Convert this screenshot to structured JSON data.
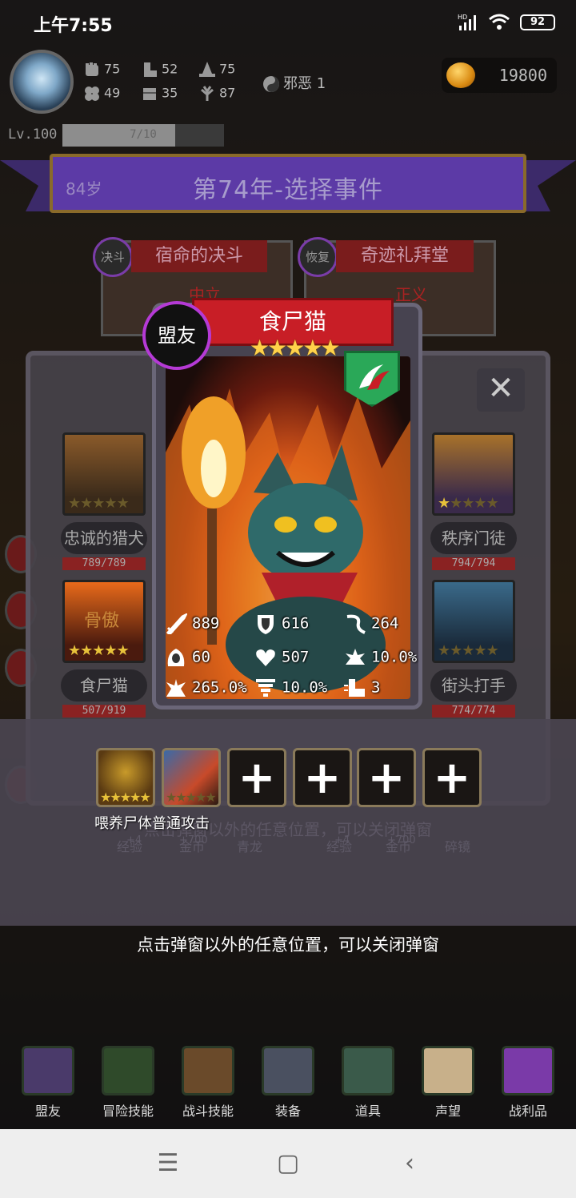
{
  "status_bar": {
    "time": "上午7:55",
    "battery": "92",
    "signal_label": "HD"
  },
  "player": {
    "stats": [
      {
        "icon": "fist-icon",
        "value": "75"
      },
      {
        "icon": "boot-icon",
        "value": "52"
      },
      {
        "icon": "wizard-hat-icon",
        "value": "75"
      },
      {
        "icon": "clover-icon",
        "value": "49"
      },
      {
        "icon": "chest-icon",
        "value": "35"
      },
      {
        "icon": "leaf-icon",
        "value": "87"
      }
    ],
    "alignment": "邪恶 1",
    "coins": "19800",
    "level": "Lv.100",
    "exp": "7/10",
    "exp_fraction": 0.7
  },
  "banner": {
    "age": "84岁",
    "title": "第74年-选择事件"
  },
  "events": [
    {
      "tag": "决斗",
      "name": "宿命的决斗",
      "alignment": "中立"
    },
    {
      "tag": "恢复",
      "name": "奇迹礼拜堂",
      "alignment": "正义"
    }
  ],
  "ghost_rewards": {
    "left": [
      {
        "top": "+4",
        "label": "经验"
      },
      {
        "top": "+700",
        "label": "金币"
      },
      {
        "top": "",
        "label": "青龙"
      }
    ],
    "right": [
      {
        "top": "+4",
        "label": "经验"
      },
      {
        "top": "+700",
        "label": "金币"
      },
      {
        "top": "",
        "label": "碎镜"
      }
    ],
    "hint": "点击弹窗以外的任意位置，可以关闭弹窗"
  },
  "allies": [
    {
      "name": "忠诚的猎犬",
      "hp": "789/789",
      "stars": 0,
      "colors": [
        "#3a2a1a",
        "#8a5a2a"
      ]
    },
    {
      "name": "秩序门徒",
      "hp": "794/794",
      "stars": 1,
      "colors": [
        "#3a2a4a",
        "#a8722a"
      ]
    },
    {
      "name": "食尸猫",
      "hp": "507/919",
      "stars": 5,
      "colors": [
        "#4a1a0e",
        "#e86a1a"
      ],
      "overlay": "骨傲"
    },
    {
      "name": "街头打手",
      "hp": "774/774",
      "stars": 0,
      "colors": [
        "#1a2a3a",
        "#3a6a8a"
      ]
    }
  ],
  "card": {
    "tag": "盟友",
    "name": "食尸猫",
    "stars": "★★★★★",
    "stats": [
      {
        "icon": "sword-icon",
        "value": "889"
      },
      {
        "icon": "shield-icon",
        "value": "616"
      },
      {
        "icon": "whip-icon",
        "value": "264"
      },
      {
        "icon": "hood-icon",
        "value": "60"
      },
      {
        "icon": "heart-icon",
        "value": "507"
      },
      {
        "icon": "burst-icon",
        "value": "10.0%"
      },
      {
        "icon": "splat-icon",
        "value": "265.0%"
      },
      {
        "icon": "tornado-icon",
        "value": "10.0%"
      },
      {
        "icon": "boot-icon",
        "value": "3"
      }
    ]
  },
  "skills": {
    "label": "喂养尸体普通攻击",
    "slot_add": "+"
  },
  "close_hint": "点击弹窗以外的任意位置，可以关闭弹窗",
  "nav": [
    {
      "label": "盟友",
      "icon": "gauntlet-icon"
    },
    {
      "label": "冒险技能",
      "icon": "book-icon"
    },
    {
      "label": "战斗技能",
      "icon": "backpack-icon"
    },
    {
      "label": "装备",
      "icon": "crossed-swords-icon"
    },
    {
      "label": "道具",
      "icon": "pouch-icon"
    },
    {
      "label": "声望",
      "icon": "scroll-icon"
    },
    {
      "label": "战利品",
      "icon": "treasure-chest-icon"
    }
  ],
  "close_symbol": "✕"
}
